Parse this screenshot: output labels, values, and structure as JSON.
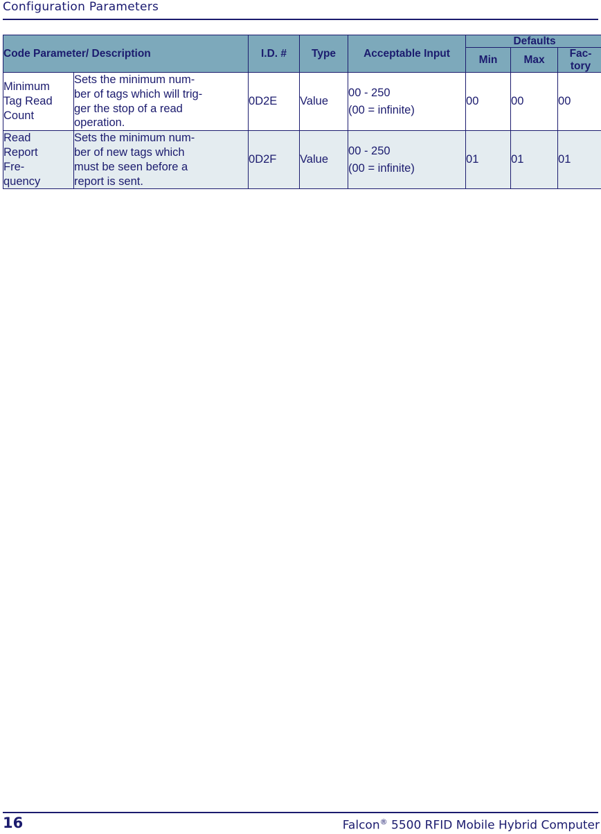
{
  "page": {
    "running_head": "Configuration Parameters",
    "page_number": "16",
    "product_name_before_mark": "Falcon",
    "registered_mark": "®",
    "product_name_after_mark": " 5500 RFID Mobile Hybrid Computer"
  },
  "colors": {
    "text_navy": "#1b1b6e",
    "header_fill": "#7da9bb",
    "alt_row_fill": "#e4ecf0",
    "row_fill": "#ffffff",
    "border": "#1b1b6e"
  },
  "table": {
    "headers": {
      "code_parameter": "Code Parameter/ Description",
      "id_number": "I.D. #",
      "type": "Type",
      "acceptable_input": "Acceptable Input",
      "defaults": "Defaults",
      "min": "Min",
      "max": "Max",
      "factory_line1": "Fac-",
      "factory_line2": "tory"
    },
    "rows": [
      {
        "name_lines": [
          "Minimum",
          "Tag Read",
          "Count"
        ],
        "description_lines": [
          "Sets the minimum num-",
          "ber of tags which will trig-",
          "ger the stop of a read",
          "operation."
        ],
        "id": "0D2E",
        "type": "Value",
        "input_line1": "00 - 250",
        "input_line2": "(00 = infinite)",
        "min": "00",
        "max": "00",
        "factory": "00"
      },
      {
        "name_lines": [
          "Read",
          "Report",
          "Fre-",
          "quency"
        ],
        "description_lines": [
          "Sets the minimum num-",
          "ber of new tags which",
          "must be seen before a",
          "report is sent."
        ],
        "id": "0D2F",
        "type": "Value",
        "input_line1": "00 - 250",
        "input_line2": "(00 = infinite)",
        "min": "01",
        "max": "01",
        "factory": "01"
      }
    ]
  }
}
